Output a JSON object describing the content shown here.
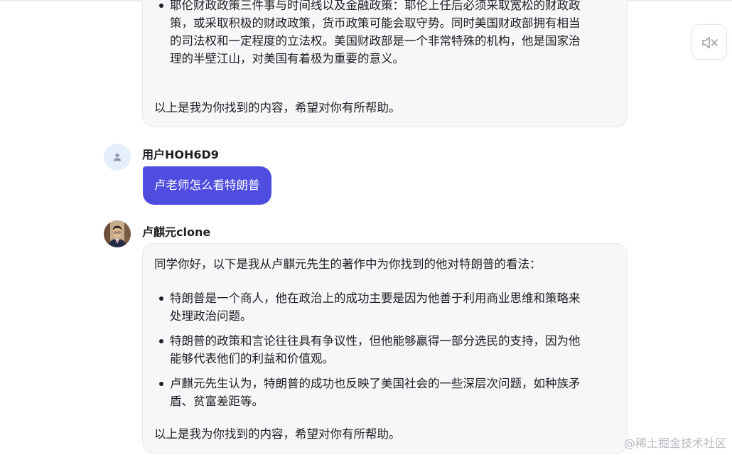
{
  "chat": {
    "top_message": {
      "bullet": {
        "lines": [
          "耶伦财政政策三件事与时间线以及金融政策：耶伦上任后必须采取宽松的财政政",
          "策，或采取积极的财政政策，货币政策可能会取守势。同时美国财政部拥有相当",
          "的司法权和一定程度的立法权。美国财政部是一个非常特殊的机构，他是国家治",
          "理的半壁江山，对美国有着极为重要的意义。"
        ]
      },
      "closing": "以上是我为你找到的内容，希望对你有所帮助。"
    },
    "user": {
      "name": "用户HOH6D9",
      "message": "卢老师怎么看特朗普"
    },
    "bot": {
      "name": "卢麒元clone",
      "intro": "同学你好，以下是我从卢麒元先生的著作中为你找到的他对特朗普的看法：",
      "bullets": [
        {
          "lines": [
            "特朗普是一个商人，他在政治上的成功主要是因为他善于利用商业思维和策略来",
            "处理政治问题。"
          ]
        },
        {
          "lines": [
            "特朗普的政策和言论往往具有争议性，但他能够赢得一部分选民的支持，因为他",
            "能够代表他们的利益和价值观。"
          ]
        },
        {
          "lines": [
            "卢麒元先生认为，特朗普的成功也反映了美国社会的一些深层次问题，如种族矛",
            "盾、贫富差距等。"
          ]
        }
      ],
      "closing": "以上是我为你找到的内容，希望对你有所帮助。"
    }
  },
  "controls": {
    "mute_icon": "speaker-muted-icon"
  },
  "watermark": "@稀土掘金技术社区",
  "colors": {
    "accent": "#4f4ce0",
    "bubble_bg": "#f7f7f9",
    "bubble_border": "#e8e8ed",
    "user_avatar_bg": "#e5eefb"
  }
}
